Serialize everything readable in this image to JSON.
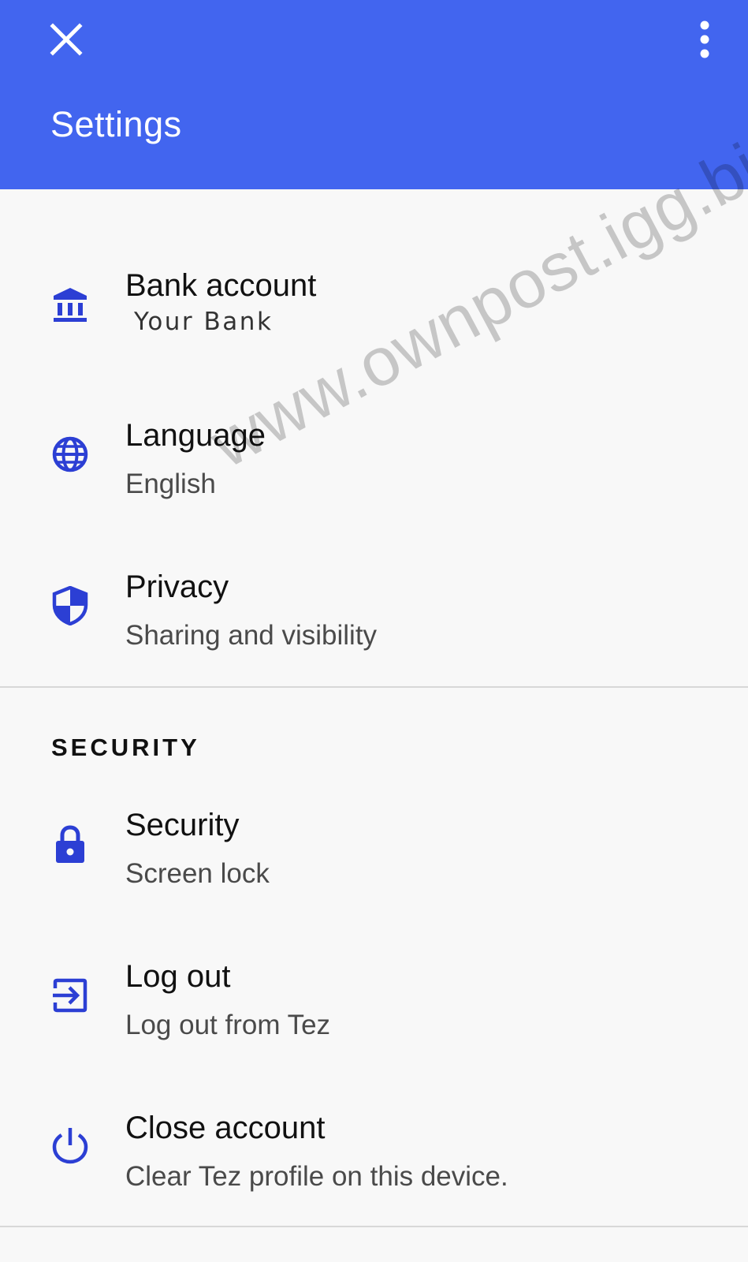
{
  "appbar": {
    "title": "Settings",
    "close_icon": "close-icon",
    "more_icon": "more-vert-icon",
    "color": "#4265ef"
  },
  "items": [
    {
      "icon": "bank-icon",
      "title": "Bank account",
      "subtitle": "Your Bank"
    },
    {
      "icon": "globe-icon",
      "title": "Language",
      "subtitle": "English"
    },
    {
      "icon": "shield-icon",
      "title": "Privacy",
      "subtitle": "Sharing and visibility"
    }
  ],
  "security_section": {
    "header": "SECURITY",
    "items": [
      {
        "icon": "lock-icon",
        "title": "Security",
        "subtitle": "Screen lock"
      },
      {
        "icon": "logout-icon",
        "title": "Log out",
        "subtitle": "Log out from Tez"
      },
      {
        "icon": "power-icon",
        "title": "Close account",
        "subtitle": "Clear Tez profile on this device."
      }
    ]
  },
  "watermark": "www.ownpost.igg.biz",
  "icon_color": "#2c3fd4"
}
